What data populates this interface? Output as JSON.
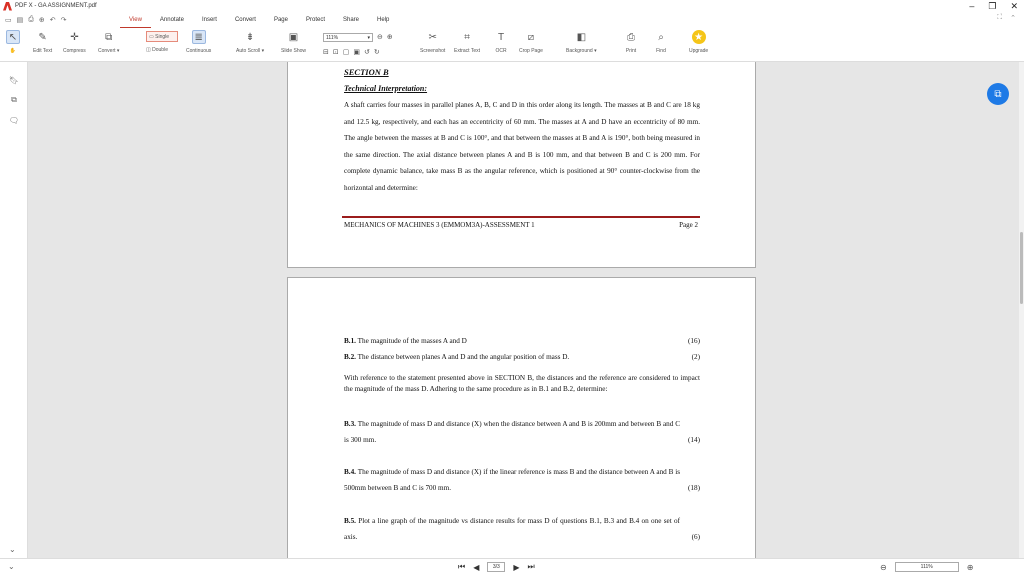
{
  "window": {
    "title": "PDF X - GA ASSIGNMENT.pdf",
    "minimize": "–",
    "maximize": "❐",
    "close": "✕"
  },
  "menu": {
    "tabs": [
      "View",
      "Annotate",
      "Insert",
      "Convert",
      "Page",
      "Protect",
      "Share",
      "Help"
    ],
    "active_tab": "View"
  },
  "toolbar": {
    "edit_text": "Edit Text",
    "compress": "Compress",
    "convert": "Convert ▾",
    "single": "Single",
    "double": "Double",
    "continuous": "Continuous",
    "auto_scroll": "Auto Scroll ▾",
    "slide_show": "Slide Show",
    "zoom": "111%",
    "screenshot": "Screenshot",
    "extract_text": "Extract Text",
    "ocr": "OCR",
    "crop_page": "Crop Page",
    "background": "Background ▾",
    "print": "Print",
    "find": "Find",
    "upgrade": "Upgrade"
  },
  "page1": {
    "section": "SECTION B",
    "subsection": "Technical Interpretation:",
    "paragraph": "A shaft carries four masses in parallel planes A, B, C and D in this order along its length. The masses at B and C are 18 kg and 12.5 kg, respectively, and each has an eccentricity of 60 mm. The masses at A and D have an eccentricity of 80 mm. The angle between the masses at B and C is 100°, and that between the masses at B and A is 190°, both being measured in the same direction. The axial distance between planes A and B is 100 mm, and that between B and C is 200 mm. For complete dynamic balance, take mass B as the angular reference, which is positioned at 90° counter-clockwise from the horizontal and determine:",
    "footer_left": "MECHANICS OF MACHINES 3 (EMMOM3A)-ASSESSMENT 1",
    "footer_right": "Page 2"
  },
  "page2": {
    "q1": {
      "num": "B.1.",
      "text": "The magnitude of the masses A and D",
      "marks": "(16)"
    },
    "q2": {
      "num": "B.2.",
      "text": "The distance between planes A and D and the angular position of mass D.",
      "marks": "(2)"
    },
    "intro": "With reference to the statement presented above in SECTION B, the distances and the reference are considered to impact the magnitude of the mass D. Adhering to the same procedure as in B.1 and B.2, determine:",
    "q3": {
      "num": "B.3.",
      "text": "The magnitude of mass D and distance (X) when the distance between A and B is 200mm and between B and C is 300 mm.",
      "marks": "(14)"
    },
    "q4": {
      "num": "B.4.",
      "text": "The magnitude of mass D and distance (X) if the linear reference is mass B and the distance between A and B is 500mm between B and C is 700 mm.",
      "marks": "(18)"
    },
    "q5": {
      "num": "B.5.",
      "text": "Plot a line graph of the magnitude vs distance results for mass D of questions B.1, B.3 and B.4 on one set of axis.",
      "marks": "(6)"
    }
  },
  "status": {
    "page": "3/3",
    "zoom": "111%"
  }
}
